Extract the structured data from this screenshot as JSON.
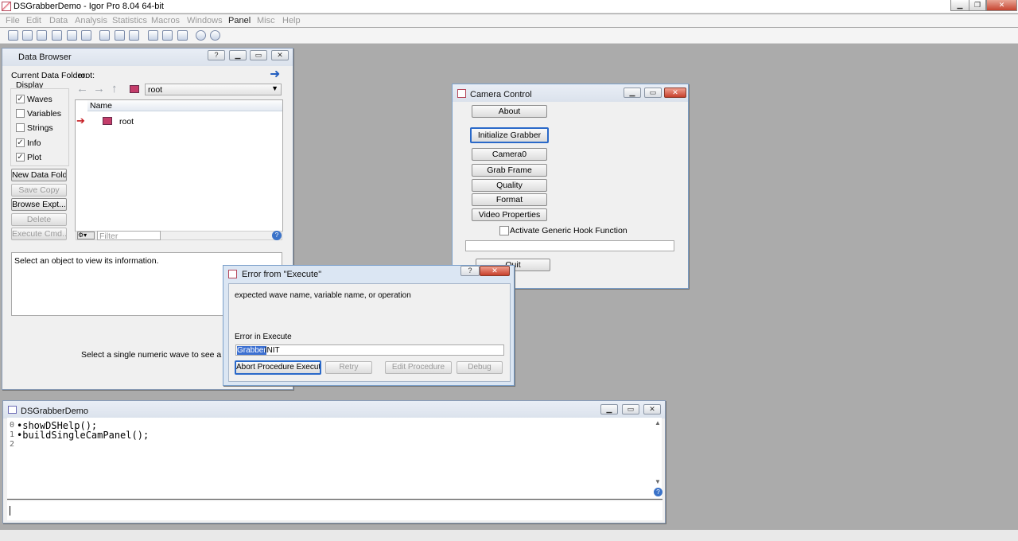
{
  "app": {
    "title": "DSGrabberDemo - Igor Pro 8.04 64-bit"
  },
  "menu": [
    "File",
    "Edit",
    "Data",
    "Analysis",
    "Statistics",
    "Macros",
    "Windows",
    "Panel",
    "Misc",
    "Help"
  ],
  "data_browser": {
    "title": "Data Browser",
    "current_folder_label": "Current Data Folder:",
    "current_folder_value": "root:",
    "display_label": "Display",
    "checks": [
      {
        "label": "Waves",
        "checked": true
      },
      {
        "label": "Variables",
        "checked": false
      },
      {
        "label": "Strings",
        "checked": false
      },
      {
        "label": "Info",
        "checked": true
      },
      {
        "label": "Plot",
        "checked": true
      }
    ],
    "buttons": [
      "New Data Folder",
      "Save Copy",
      "Browse Expt...",
      "Delete",
      "Execute Cmd..."
    ],
    "folder_select": "root",
    "column_name": "Name",
    "tree_item": "root",
    "filter_placeholder": "Filter",
    "info_text": "Select an object to view its information.",
    "plot_text": "Select a single numeric wave to see a plot."
  },
  "camera": {
    "title": "Camera Control",
    "buttons": [
      "About",
      "Initialize Grabber",
      "Camera0",
      "Grab Frame",
      "Quality",
      "Format",
      "Video Properties"
    ],
    "hook_label": "Activate Generic Hook Function",
    "quit": "Quit"
  },
  "error": {
    "title": "Error from \"Execute\"",
    "message": "expected wave name, variable name, or operation",
    "error_in": "Error in  Execute",
    "cmd_selected": "Grabber",
    "cmd_rest": " INIT",
    "buttons": [
      "Abort Procedure Execution",
      "Retry",
      "Edit Procedure",
      "Debug"
    ]
  },
  "history": {
    "title": "DSGrabberDemo",
    "lines": [
      "•showDSHelp();",
      "•buildSingleCamPanel();"
    ],
    "line_numbers": [
      "0",
      "1",
      "2"
    ]
  }
}
